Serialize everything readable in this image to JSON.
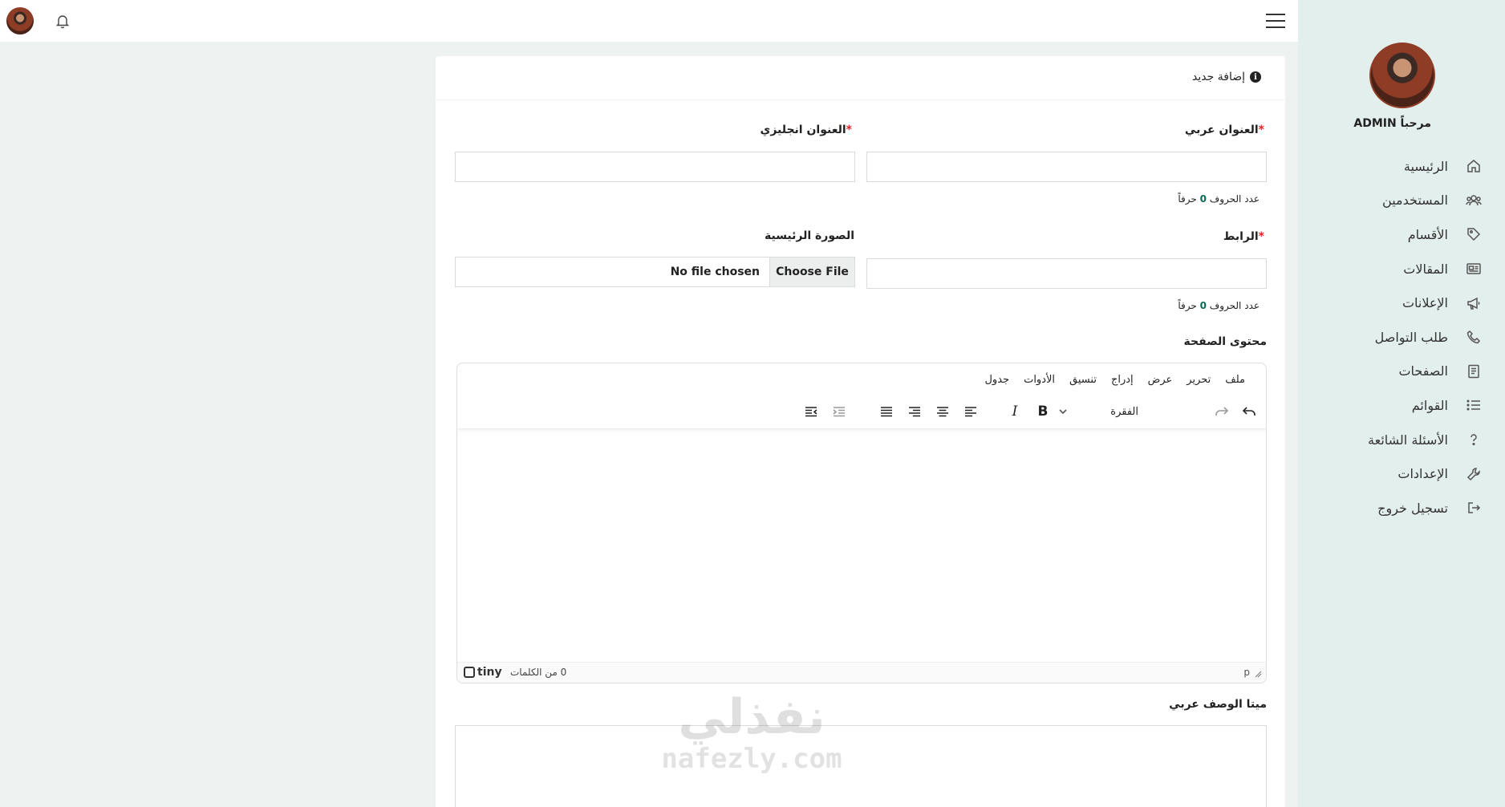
{
  "sidebar": {
    "welcome": "مرحباً ADMIN",
    "items": [
      {
        "label": "الرئيسية",
        "icon": "home-icon"
      },
      {
        "label": "المستخدمين",
        "icon": "users-icon"
      },
      {
        "label": "الأقسام",
        "icon": "tag-icon"
      },
      {
        "label": "المقالات",
        "icon": "newspaper-icon"
      },
      {
        "label": "الإعلانات",
        "icon": "megaphone-icon"
      },
      {
        "label": "طلب التواصل",
        "icon": "phone-icon"
      },
      {
        "label": "الصفحات",
        "icon": "page-icon"
      },
      {
        "label": "القوائم",
        "icon": "list-icon"
      },
      {
        "label": "الأسئلة الشائعة",
        "icon": "question-icon"
      },
      {
        "label": "الإعدادات",
        "icon": "wrench-icon"
      },
      {
        "label": "تسجيل خروج",
        "icon": "logout-icon"
      }
    ]
  },
  "card": {
    "title": "إضافة جديد",
    "fields": {
      "title_ar": {
        "label": "العنوان عربي",
        "required": "*",
        "value": ""
      },
      "title_en": {
        "label": "العنوان انجليزي",
        "required": "*",
        "value": ""
      },
      "link": {
        "label": "الرابط",
        "required": "*",
        "value": ""
      },
      "main_image": {
        "label": "الصورة الرئيسية",
        "button": "Choose File",
        "status": "No file chosen"
      },
      "content": {
        "label": "محتوى الصفحة"
      },
      "meta_desc_ar": {
        "label": "ميتا الوصف عربي",
        "value": ""
      }
    },
    "counter_prefix": "عدد الحروف",
    "counter_value": "0",
    "counter_suffix": "حرفاً"
  },
  "editor": {
    "menu": [
      "ملف",
      "تحرير",
      "عرض",
      "إدراج",
      "تنسيق",
      "الأدوات",
      "جدول"
    ],
    "block_format": "الفقرة",
    "bold": "B",
    "italic": "I",
    "status_path": "p",
    "word_count": "0 من الكلمات",
    "brand": "tiny"
  },
  "watermark": {
    "ar": "نفذلي",
    "en": "nafezly.com"
  }
}
